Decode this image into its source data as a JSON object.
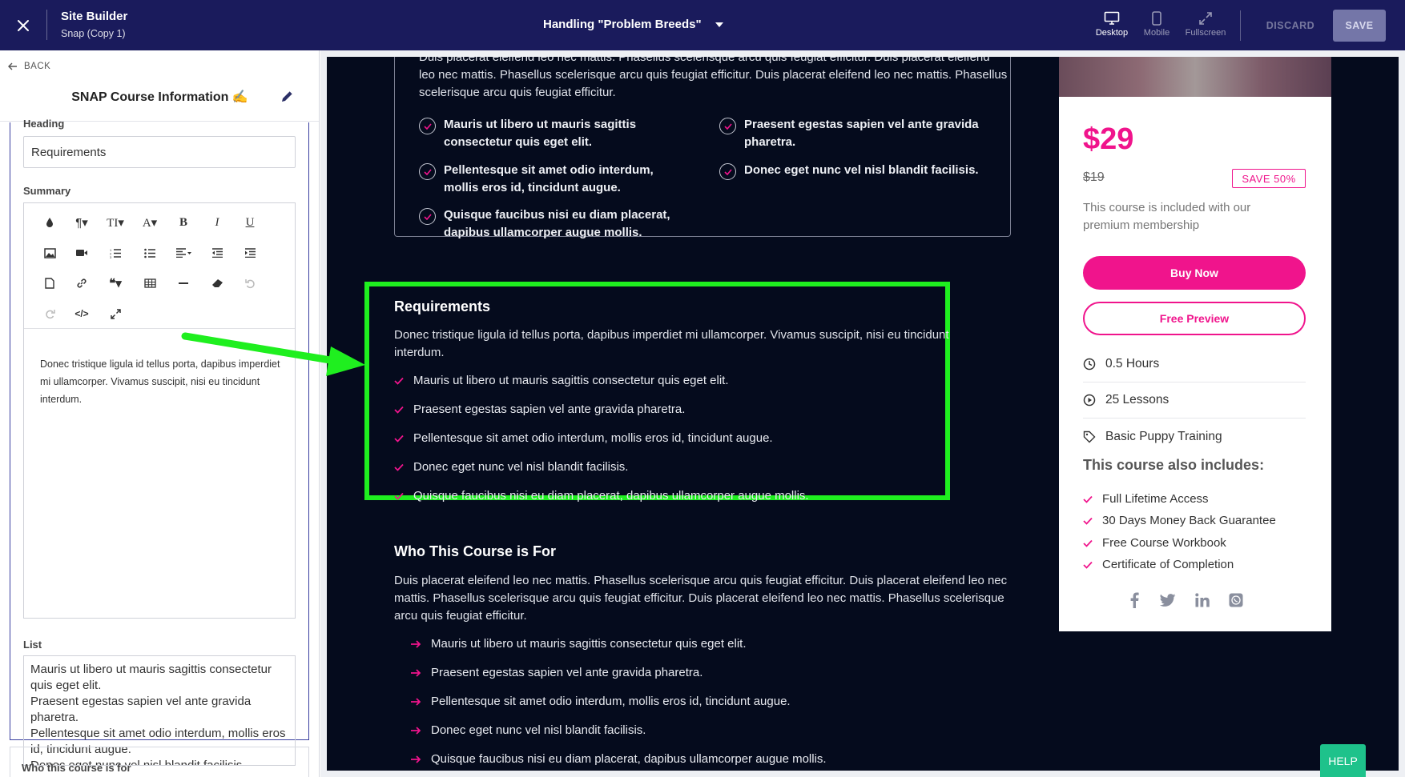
{
  "topbar": {
    "app_title": "Site Builder",
    "app_subtitle": "Snap (Copy 1)",
    "page_title": "Handling \"Problem Breeds\"",
    "devices": [
      {
        "label": "Desktop"
      },
      {
        "label": "Mobile"
      },
      {
        "label": "Fullscreen"
      }
    ],
    "discard_label": "DISCARD",
    "save_label": "SAVE"
  },
  "sidebar": {
    "back_label": "BACK",
    "panel_title": "SNAP Course Information ✍",
    "heading_label": "Heading",
    "heading_value": "Requirements",
    "summary_label": "Summary",
    "summary_text": "Donec tristique ligula id tellus porta, dapibus imperdiet mi ullamcorper. Vivamus suscipit, nisi eu tincidunt interdum.",
    "list_label": "List",
    "list_lines": [
      "Mauris ut libero ut mauris sagittis consectetur quis eget elit.",
      "Praesent egestas sapien vel ante gravida pharetra.",
      "Pellentesque sit amet odio interdum, mollis eros id, tincidunt augue.",
      "Donec eget nunc vel nisl blandit facilisis."
    ],
    "next_section_label": "Who this course is for"
  },
  "preview": {
    "top_paragraph": "Duis placerat eleifend leo nec mattis. Phasellus scelerisque arcu quis feugiat efficitur. Duis placerat eleifend leo nec mattis. Phasellus scelerisque arcu quis feugiat efficitur. Duis placerat eleifend leo nec mattis. Phasellus scelerisque arcu quis feugiat efficitur.",
    "top_checks": [
      "Mauris ut libero ut mauris sagittis consectetur quis eget elit.",
      "Praesent egestas sapien vel ante gravida pharetra.",
      "Pellentesque sit amet odio interdum, mollis eros id, tincidunt augue.",
      "Donec eget nunc vel nisl blandit facilisis.",
      "Quisque faucibus nisi eu diam placerat, dapibus ullamcorper augue mollis."
    ],
    "requirements": {
      "heading": "Requirements",
      "paragraph": "Donec tristique ligula id tellus porta, dapibus imperdiet mi ullamcorper. Vivamus suscipit, nisi eu tincidunt interdum.",
      "items": [
        "Mauris ut libero ut mauris sagittis consectetur quis eget elit.",
        "Praesent egestas sapien vel ante gravida pharetra.",
        "Pellentesque sit amet odio interdum, mollis eros id, tincidunt augue.",
        "Donec eget nunc vel nisl blandit facilisis.",
        "Quisque faucibus nisi eu diam placerat, dapibus ullamcorper augue mollis."
      ]
    },
    "who_for": {
      "heading": "Who This Course is For",
      "paragraph": "Duis placerat eleifend leo nec mattis. Phasellus scelerisque arcu quis feugiat efficitur. Duis placerat eleifend leo nec mattis. Phasellus scelerisque arcu quis feugiat efficitur. Duis placerat eleifend leo nec mattis. Phasellus scelerisque arcu quis feugiat efficitur.",
      "items": [
        "Mauris ut libero ut mauris sagittis consectetur quis eget elit.",
        "Praesent egestas sapien vel ante gravida pharetra.",
        "Pellentesque sit amet odio interdum, mollis eros id, tincidunt augue.",
        "Donec eget nunc vel nisl blandit facilisis.",
        "Quisque faucibus nisi eu diam placerat, dapibus ullamcorper augue mollis."
      ]
    },
    "price_card": {
      "price": "$29",
      "old_price": "$19",
      "save_badge": "SAVE 50%",
      "included_text": "This course is included with our premium membership",
      "buy_label": "Buy Now",
      "preview_label": "Free Preview",
      "meta": [
        {
          "icon": "clock-icon",
          "text": "0.5 Hours"
        },
        {
          "icon": "play-circle-icon",
          "text": "25 Lessons"
        },
        {
          "icon": "tag-icon",
          "text": "Basic Puppy Training"
        }
      ],
      "also_heading": "This course also includes:",
      "also_items": [
        "Full Lifetime Access",
        "30 Days Money Back Guarantee",
        "Free Course Workbook",
        "Certificate of Completion"
      ],
      "social": [
        "facebook-icon",
        "twitter-icon",
        "linkedin-icon",
        "whatsapp-icon"
      ]
    }
  },
  "help_label": "HELP",
  "colors": {
    "topbar": "#1a1b5c",
    "accent_pink": "#f0148c",
    "highlight_green": "#1fef1f",
    "canvas_bg": "#050b1d",
    "help_green": "#1ec28b"
  }
}
